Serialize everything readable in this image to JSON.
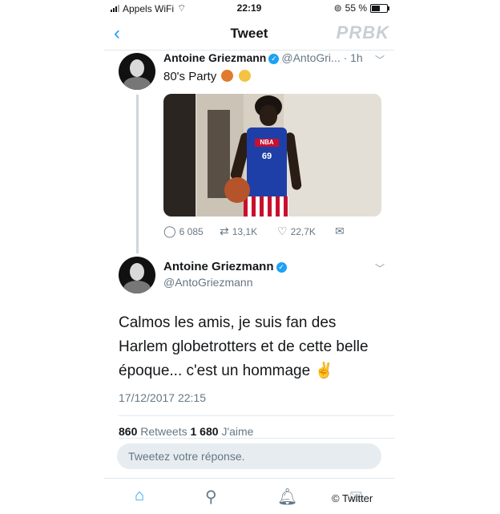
{
  "status_bar": {
    "carrier": "Appels WiFi",
    "time": "22:19",
    "battery_text": "55 %",
    "battery_level": 0.55
  },
  "header": {
    "title": "Tweet",
    "back_icon": "chevron-left-icon",
    "watermark": "PRBK"
  },
  "tweet1": {
    "name": "Antoine Griezmann",
    "handle": "@AntoGri...",
    "age": "· 1h",
    "text": "80's Party",
    "emojis": [
      "basketball-emoji",
      "rofl-emoji"
    ],
    "jersey_text": "69",
    "jersey_badge": "NBA",
    "reply_count": "6 085",
    "retweet_count": "13,1K",
    "like_count": "22,7K"
  },
  "tweet2": {
    "name": "Antoine Griezmann",
    "handle": "@AntoGriezmann",
    "text": "Calmos les amis, je suis fan des Harlem globetrotters et de cette belle époque... c'est un hommage ✌️",
    "timestamp": "17/12/2017 22:15",
    "retweets_count": "860",
    "retweets_label": "Retweets",
    "likes_count": "1 680",
    "likes_label": "J'aime"
  },
  "reply_box": {
    "placeholder": "Tweetez votre réponse."
  },
  "tabbar": {
    "items": [
      "home-icon",
      "search-icon",
      "notifications-icon",
      "messages-icon"
    ]
  },
  "credit": "© Twitter",
  "colors": {
    "accent": "#1da1f2",
    "muted": "#657786",
    "text": "#14171a"
  }
}
